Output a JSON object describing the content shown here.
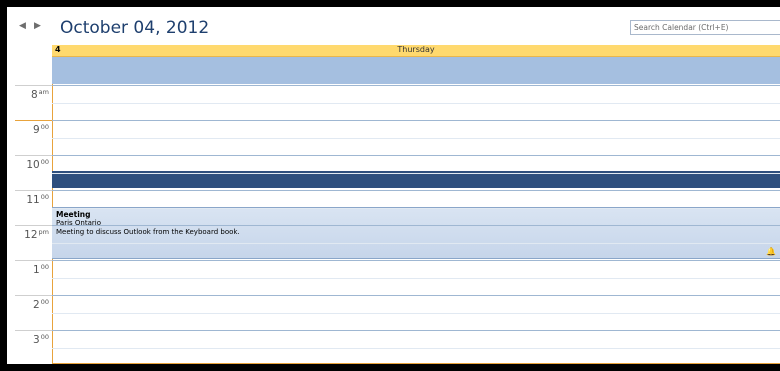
{
  "nav": {
    "prev_icon": "◀",
    "next_icon": "▶"
  },
  "header": {
    "date_title": "October 04, 2012",
    "search_placeholder": "Search Calendar (Ctrl+E)"
  },
  "day": {
    "number": "4",
    "name": "Thursday"
  },
  "time_slots": [
    {
      "hour": "8",
      "suffix": "am"
    },
    {
      "hour": "9",
      "suffix": "00"
    },
    {
      "hour": "10",
      "suffix": "00"
    },
    {
      "hour": "11",
      "suffix": "00"
    },
    {
      "hour": "12",
      "suffix": "pm"
    },
    {
      "hour": "1",
      "suffix": "00"
    },
    {
      "hour": "2",
      "suffix": "00"
    },
    {
      "hour": "3",
      "suffix": "00"
    }
  ],
  "appointment": {
    "subject": "Meeting",
    "location": "Paris Ontario",
    "notes": "Meeting to discuss Outlook from the Keyboard book.",
    "reminder_icon": "🔔"
  },
  "colors": {
    "accent": "#1e3f6e",
    "day_header": "#ffd96e",
    "all_day": "#a5bfe0",
    "selection": "#2e4f7e",
    "appointment": "#d9e4f2"
  }
}
